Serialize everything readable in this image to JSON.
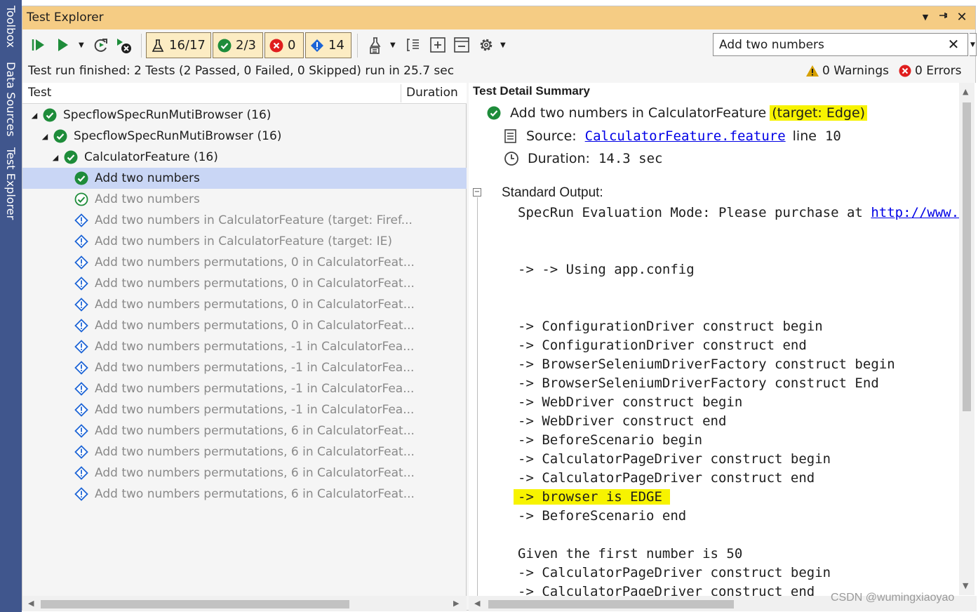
{
  "dock": {
    "tabs": [
      "Toolbox",
      "Data Sources",
      "Test Explorer"
    ]
  },
  "window": {
    "title": "Test Explorer"
  },
  "toolbar": {
    "filters": [
      {
        "label": "16/17",
        "icon": "flask-icon"
      },
      {
        "label": "2/3",
        "icon": "passed-icon"
      },
      {
        "label": "0",
        "icon": "failed-icon"
      },
      {
        "label": "14",
        "icon": "not-run-icon"
      }
    ]
  },
  "search": {
    "value": "Add two numbers",
    "clear": "✕"
  },
  "status": {
    "text": "Test run finished: 2 Tests (2 Passed, 0 Failed, 0 Skipped) run in 25.7 sec",
    "warnings": "0 Warnings",
    "errors": "0 Errors"
  },
  "tree": {
    "columns": {
      "test": "Test",
      "duration": "Duration"
    },
    "rows": [
      {
        "label": "SpecflowSpecRunMutiBrowser  (16)",
        "level": 0,
        "state": "passed",
        "expander": "◢"
      },
      {
        "label": "SpecflowSpecRunMutiBrowser  (16)",
        "level": 1,
        "state": "passed",
        "expander": "◢"
      },
      {
        "label": "CalculatorFeature  (16)",
        "level": 2,
        "state": "passed",
        "expander": "◢"
      },
      {
        "label": "Add two numbers",
        "level": 3,
        "state": "passed",
        "selected": true
      },
      {
        "label": "Add two numbers",
        "level": 3,
        "state": "passed-outline"
      },
      {
        "label": "Add two numbers in CalculatorFeature (target: Firef...",
        "level": 3,
        "state": "notrun"
      },
      {
        "label": "Add two numbers in CalculatorFeature (target: IE)",
        "level": 3,
        "state": "notrun"
      },
      {
        "label": "Add two numbers permutations, 0 in CalculatorFeat...",
        "level": 3,
        "state": "notrun"
      },
      {
        "label": "Add two numbers permutations, 0 in CalculatorFeat...",
        "level": 3,
        "state": "notrun"
      },
      {
        "label": "Add two numbers permutations, 0 in CalculatorFeat...",
        "level": 3,
        "state": "notrun"
      },
      {
        "label": "Add two numbers permutations, 0 in CalculatorFeat...",
        "level": 3,
        "state": "notrun"
      },
      {
        "label": "Add two numbers permutations, -1 in CalculatorFea...",
        "level": 3,
        "state": "notrun"
      },
      {
        "label": "Add two numbers permutations, -1 in CalculatorFea...",
        "level": 3,
        "state": "notrun"
      },
      {
        "label": "Add two numbers permutations, -1 in CalculatorFea...",
        "level": 3,
        "state": "notrun"
      },
      {
        "label": "Add two numbers permutations, -1 in CalculatorFea...",
        "level": 3,
        "state": "notrun"
      },
      {
        "label": "Add two numbers permutations, 6 in CalculatorFeat...",
        "level": 3,
        "state": "notrun"
      },
      {
        "label": "Add two numbers permutations, 6 in CalculatorFeat...",
        "level": 3,
        "state": "notrun"
      },
      {
        "label": "Add two numbers permutations, 6 in CalculatorFeat...",
        "level": 3,
        "state": "notrun"
      },
      {
        "label": "Add two numbers permutations, 6 in CalculatorFeat...",
        "level": 3,
        "state": "notrun"
      }
    ]
  },
  "detail": {
    "title": "Test Detail Summary",
    "name": "Add two numbers in CalculatorFeature",
    "target": "(target: Edge)",
    "source_label": "Source:",
    "source_link": "CalculatorFeature.feature",
    "source_line_label": "line",
    "source_line": "10",
    "duration_label": "Duration:",
    "duration_value": "14.3 sec",
    "stdout_label": "Standard Output:",
    "stdout_lines": [
      {
        "text": "SpecRun Evaluation Mode: Please purchase at ",
        "link": "http://www."
      },
      {
        "text": ""
      },
      {
        "text": ""
      },
      {
        "text": "-> -> Using app.config"
      },
      {
        "text": ""
      },
      {
        "text": ""
      },
      {
        "text": "-> ConfigurationDriver construct begin"
      },
      {
        "text": "-> ConfigurationDriver construct end"
      },
      {
        "text": "-> BrowserSeleniumDriverFactory construct begin"
      },
      {
        "text": "-> BrowserSeleniumDriverFactory construct End"
      },
      {
        "text": "-> WebDriver construct begin"
      },
      {
        "text": "-> WebDriver construct end"
      },
      {
        "text": "-> BeforeScenario begin"
      },
      {
        "text": "-> CalculatorPageDriver construct begin"
      },
      {
        "text": "-> CalculatorPageDriver construct end"
      },
      {
        "text": "-> browser is EDGE ",
        "highlight": true
      },
      {
        "text": "-> BeforeScenario end"
      },
      {
        "text": ""
      },
      {
        "text": "Given the first number is 50"
      },
      {
        "text": "-> CalculatorPageDriver construct begin"
      },
      {
        "text": "-> CalculatorPageDriver construct end"
      }
    ]
  },
  "watermark": "CSDN @wumingxiaoyao",
  "colors": {
    "titlebar": "#f5cc84",
    "dock": "#40568d",
    "selection": "#c9d6f5",
    "highlight": "#f7f300",
    "passed": "#1e8c3a",
    "failed": "#e01e1e",
    "notrun": "#1c64d6"
  }
}
